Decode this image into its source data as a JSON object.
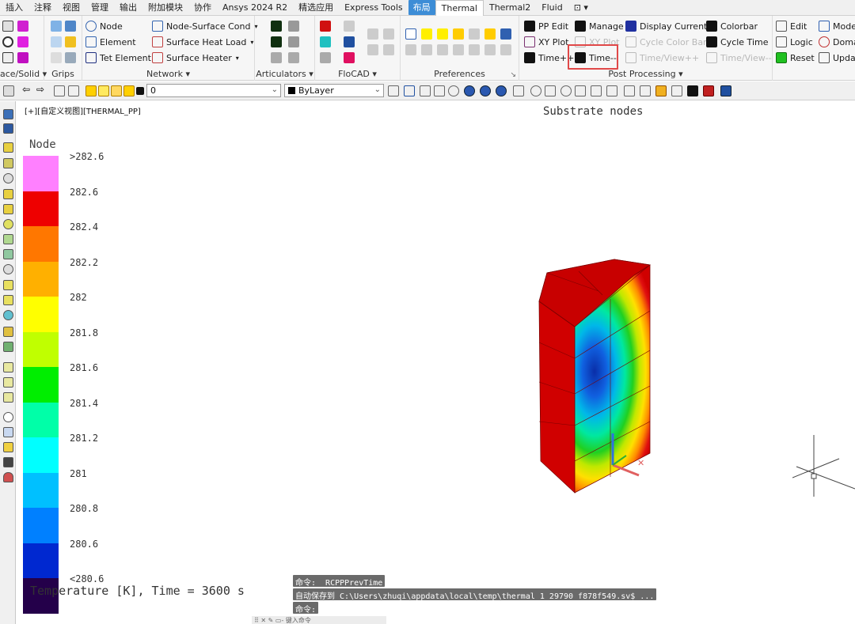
{
  "tabs": [
    {
      "label": "插入",
      "style": "normal"
    },
    {
      "label": "注释",
      "style": "normal"
    },
    {
      "label": "视图",
      "style": "normal"
    },
    {
      "label": "管理",
      "style": "normal"
    },
    {
      "label": "输出",
      "style": "normal"
    },
    {
      "label": "附加模块",
      "style": "normal"
    },
    {
      "label": "协作",
      "style": "normal"
    },
    {
      "label": "Ansys  2024 R2",
      "style": "normal"
    },
    {
      "label": "精选应用",
      "style": "normal"
    },
    {
      "label": "Express Tools",
      "style": "normal"
    },
    {
      "label": "布局",
      "style": "blue"
    },
    {
      "label": "Thermal",
      "style": "selected"
    },
    {
      "label": "Thermal2",
      "style": "normal"
    },
    {
      "label": "Fluid",
      "style": "normal"
    },
    {
      "label": "⊡ ▾",
      "style": "normal"
    }
  ],
  "ribbon": {
    "groups": {
      "surface": "ace/Solid ▾",
      "grips": "Grips",
      "network": "Network ▾",
      "articulators": "Articulators ▾",
      "flocad": "FloCAD ▾",
      "preferences": "Preferences",
      "post": "Post Processing ▾",
      "corner": "↘"
    },
    "network": {
      "node": "Node",
      "element": "Element",
      "tet": "Tet Element",
      "nsc": "Node-Surface Cond",
      "shl": "Surface Heat Load",
      "sh": "Surface Heater",
      "dd": "▾"
    },
    "post": {
      "pp_edit": "PP Edit",
      "manage": "Manage",
      "display_current": "Display Current",
      "colorbar": "Colorbar",
      "xy_plot": "XY Plot",
      "xy_plot2": "XY Plot",
      "cycle_color": "Cycle Color Bars",
      "cycle_time": "Cycle Time",
      "time_pp": "Time++",
      "time_mm": "Time--",
      "time_view_pp": "Time/View++",
      "time_view_mm": "Time/View--"
    },
    "right": {
      "edit": "Edit",
      "logic": "Logic",
      "reset": "Reset",
      "mode": "Mode",
      "doma": "Doma",
      "upda": "Upda"
    }
  },
  "toolbar": {
    "layer_value": "0",
    "linetype_value": "ByLayer"
  },
  "viewport": {
    "label": "[+][自定义视图][THERMAL_PP]",
    "title": "Substrate nodes",
    "legend_title": "Node",
    "legend_labels": [
      ">282.6",
      "282.6",
      "282.4",
      "282.2",
      "282",
      "281.8",
      "281.6",
      "281.4",
      "281.2",
      "281",
      "280.8",
      "280.6",
      "<280.6"
    ],
    "legend_colors": [
      "#ff80ff",
      "#ee0000",
      "#ff7700",
      "#ffb000",
      "#ffff00",
      "#c0ff00",
      "#00ee00",
      "#00ffa8",
      "#00ffff",
      "#00c0ff",
      "#0080ff",
      "#0028d0",
      "#24004a"
    ],
    "footer": "Temperature [K], Time = 3600 s"
  },
  "commands": {
    "line1": "命令: _RCPPPrevTime",
    "line2": "自动保存到 C:\\Users\\zhuqi\\appdata\\local\\temp\\thermal_1_29790_f878f549.sv$ ...",
    "prompt": "命令:"
  },
  "bottom_bar": {
    "text": "⠿ ✕ ✎ ▭- 键入命令"
  }
}
